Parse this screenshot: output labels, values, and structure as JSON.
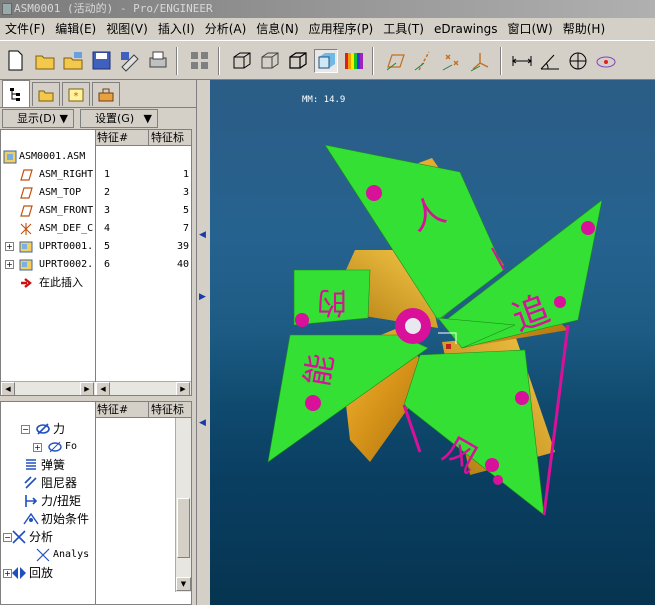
{
  "window": {
    "title": "ASM0001 (活动的) - Pro/ENGINEER"
  },
  "menu": [
    "文件(F)",
    "编辑(E)",
    "视图(V)",
    "插入(I)",
    "分析(A)",
    "信息(N)",
    "应用程序(P)",
    "工具(T)",
    "eDrawings",
    "窗口(W)",
    "帮助(H)"
  ],
  "toolbar": {
    "icons": [
      "new-file-icon",
      "open-folder-icon",
      "select-working-dir-icon",
      "save-icon",
      "save-copy-icon",
      "print-icon",
      "repaint-icon",
      "wireframe-icon",
      "hidden-line-icon",
      "no-hidden-icon",
      "shaded-icon",
      "color-appearance-icon",
      "datum-planes-icon",
      "datum-axes-icon",
      "datum-points-icon",
      "coord-systems-icon",
      "measure-distance-icon",
      "measure-angle-icon",
      "section-icon",
      "spin-center-icon"
    ]
  },
  "panel": {
    "dropdowns": {
      "show": "显示(D)",
      "settings": "设置(G)"
    },
    "model_tree": {
      "columns": [
        "特征#",
        "特征标"
      ],
      "items": [
        {
          "name": "ASM0001.ASM",
          "num": "",
          "tag": "",
          "icon": "assembly-icon",
          "expandable": false
        },
        {
          "name": "ASM_RIGHT",
          "num": "1",
          "tag": "1",
          "icon": "datum-plane-icon",
          "expandable": false
        },
        {
          "name": "ASM_TOP",
          "num": "2",
          "tag": "3",
          "icon": "datum-plane-icon",
          "expandable": false
        },
        {
          "name": "ASM_FRONT",
          "num": "3",
          "tag": "5",
          "icon": "datum-plane-icon",
          "expandable": false
        },
        {
          "name": "ASM_DEF_C",
          "num": "4",
          "tag": "7",
          "icon": "coord-system-icon",
          "expandable": false
        },
        {
          "name": "UPRT0001.",
          "num": "5",
          "tag": "39",
          "icon": "part-icon",
          "expandable": true
        },
        {
          "name": "UPRT0002.",
          "num": "6",
          "tag": "40",
          "icon": "part-icon",
          "expandable": true
        },
        {
          "name": "在此插入",
          "num": "",
          "tag": "",
          "icon": "insert-here-icon",
          "expandable": false
        }
      ]
    },
    "mechanism_tree": {
      "columns": [
        "特征#",
        "特征标"
      ],
      "items": [
        {
          "label": "力",
          "indent": 2,
          "icon": "force-icon",
          "expander": "minus"
        },
        {
          "label": "Fo",
          "indent": 3,
          "icon": "force-item-icon",
          "expander": "plus"
        },
        {
          "label": "弹簧",
          "indent": 1,
          "icon": "spring-icon",
          "expander": ""
        },
        {
          "label": "阻尼器",
          "indent": 1,
          "icon": "damper-icon",
          "expander": ""
        },
        {
          "label": "力/扭矩",
          "indent": 1,
          "icon": "force-torque-icon",
          "expander": ""
        },
        {
          "label": "初始条件",
          "indent": 1,
          "icon": "initial-condition-icon",
          "expander": ""
        },
        {
          "label": "分析",
          "indent": 0,
          "icon": "analysis-icon",
          "expander": "minus"
        },
        {
          "label": "Analys",
          "indent": 2,
          "icon": "analysis-item-icon",
          "expander": ""
        },
        {
          "label": "回放",
          "indent": 0,
          "icon": "playback-icon",
          "expander": "plus"
        }
      ]
    }
  },
  "viewport": {
    "readout": "MM: 14.9",
    "pinwheel_text": [
      "人",
      "追",
      "风",
      "能",
      "的"
    ],
    "colors": {
      "blade": "#33e033",
      "gold": "#e0a018",
      "magenta": "#d8109a",
      "background": "#245f8a"
    }
  }
}
